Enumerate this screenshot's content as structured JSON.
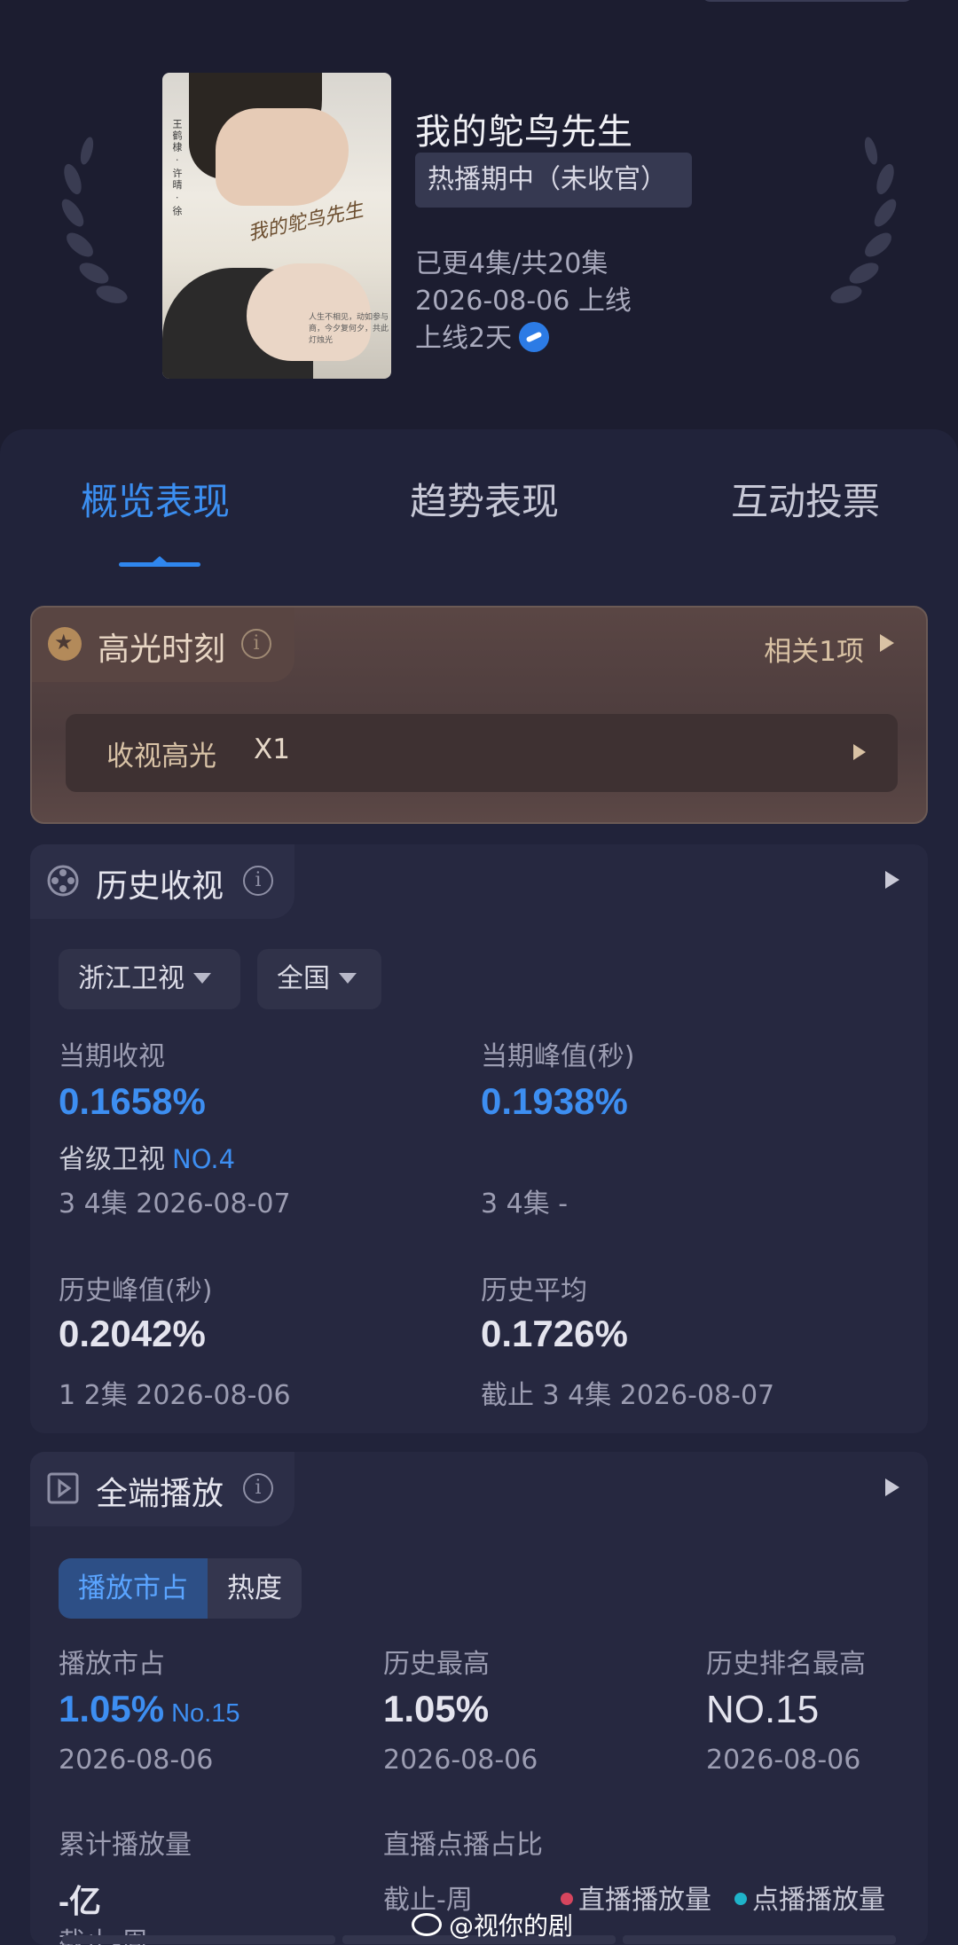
{
  "header": {
    "title": "我的鸵鸟先生",
    "status": "热播期中（未收官）",
    "episodes": "已更4集/共20集",
    "premiere": "2026-08-06 上线",
    "days_online": "上线2天",
    "channel_icon": "zhejiang-tv-icon"
  },
  "poster": {
    "script_title": "我的鸵鸟先生",
    "vertical_credits": "王鹤棣 · 许晴 · 徐",
    "tagline": "人生不相见，动如参与商，今夕复何夕，共此灯烛光"
  },
  "tabs": [
    "概览表现",
    "趋势表现",
    "互动投票"
  ],
  "highlight": {
    "title": "高光时刻",
    "related": "相关1项",
    "row_label": "收视高光",
    "row_value": "X1"
  },
  "ratings": {
    "title": "历史收视",
    "filters": [
      "浙江卫视",
      "全国"
    ],
    "current_label": "当期收视",
    "current_value": "0.1658%",
    "current_rank_label": "省级卫视",
    "current_rank": "NO.4",
    "current_sub": "3 4集 2026-08-07",
    "peak_label": "当期峰值(秒)",
    "peak_value": "0.1938%",
    "peak_sub": "3 4集 -",
    "hist_peak_label": "历史峰值(秒)",
    "hist_peak_value": "0.2042%",
    "hist_peak_sub": "1 2集 2026-08-06",
    "hist_avg_label": "历史平均",
    "hist_avg_value": "0.1726%",
    "hist_avg_sub": "截止 3 4集 2026-08-07"
  },
  "playback": {
    "title": "全端播放",
    "segments": [
      "播放市占",
      "热度"
    ],
    "share_label": "播放市占",
    "share_value": "1.05%",
    "share_rank": "No.15",
    "share_date": "2026-08-06",
    "hist_high_label": "历史最高",
    "hist_high_value": "1.05%",
    "hist_high_date": "2026-08-06",
    "rank_high_label": "历史排名最高",
    "rank_high_value": "NO.15",
    "rank_high_date": "2026-08-06",
    "cumulative_label": "累计播放量",
    "cumulative_value": "-亿",
    "cumulative_sub": "截止-周",
    "ratio_label": "直播点播占比",
    "ratio_sub": "截止-周",
    "legend_live": "直播播放量",
    "legend_vod": "点播播放量",
    "legend_live_color": "#d6455e",
    "legend_vod_color": "#1fb3c9"
  },
  "watermark": "@视你的剧"
}
